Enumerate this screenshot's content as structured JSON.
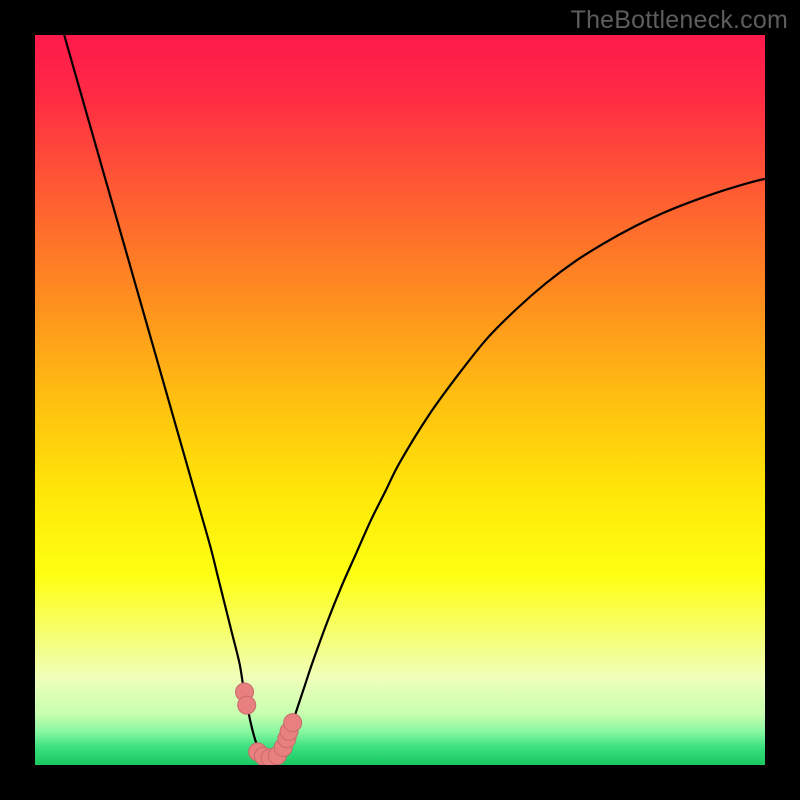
{
  "watermark": "TheBottleneck.com",
  "colors": {
    "frame": "#000000",
    "gradient_stops": [
      {
        "offset": 0.0,
        "color": "#ff1a4d"
      },
      {
        "offset": 0.08,
        "color": "#ff2a44"
      },
      {
        "offset": 0.2,
        "color": "#ff5635"
      },
      {
        "offset": 0.35,
        "color": "#ff8a20"
      },
      {
        "offset": 0.5,
        "color": "#ffbf10"
      },
      {
        "offset": 0.63,
        "color": "#ffe808"
      },
      {
        "offset": 0.74,
        "color": "#feff12"
      },
      {
        "offset": 0.82,
        "color": "#f6ff70"
      },
      {
        "offset": 0.88,
        "color": "#f0ffba"
      },
      {
        "offset": 0.93,
        "color": "#c8ffb0"
      },
      {
        "offset": 0.955,
        "color": "#86f7a0"
      },
      {
        "offset": 0.975,
        "color": "#3de180"
      },
      {
        "offset": 1.0,
        "color": "#18c85f"
      }
    ],
    "curve": "#000000",
    "markers_fill": "#e98080",
    "markers_stroke": "#c86a6a"
  },
  "chart_data": {
    "type": "line",
    "title": "",
    "xlabel": "",
    "ylabel": "",
    "xlim": [
      0,
      100
    ],
    "ylim": [
      0,
      100
    ],
    "series": [
      {
        "name": "bottleneck-curve",
        "x": [
          4,
          6,
          8,
          10,
          12,
          14,
          16,
          18,
          20,
          22,
          24,
          25,
          26,
          27,
          28,
          28.5,
          29,
          29.5,
          30,
          30.5,
          31,
          31.5,
          32,
          32.5,
          33,
          33.5,
          34,
          35,
          36,
          37,
          38,
          40,
          42,
          44,
          46,
          48,
          50,
          54,
          58,
          62,
          66,
          70,
          74,
          78,
          82,
          86,
          90,
          94,
          98,
          100
        ],
        "y": [
          100,
          93,
          86,
          79,
          72,
          65,
          58,
          51,
          44,
          37,
          30,
          26,
          22,
          18,
          14,
          11,
          8.5,
          6,
          4,
          2.5,
          1.6,
          1.1,
          0.9,
          0.9,
          1.1,
          1.6,
          2.5,
          5,
          8,
          11,
          14,
          19.5,
          24.5,
          29,
          33.5,
          37.5,
          41.5,
          48,
          53.5,
          58.5,
          62.5,
          66,
          69,
          71.5,
          73.7,
          75.6,
          77.2,
          78.6,
          79.8,
          80.3
        ]
      }
    ],
    "markers": {
      "name": "highlight-points",
      "x": [
        28.7,
        29.0,
        30.5,
        31.3,
        32.2,
        33.2,
        34.0,
        34.5,
        34.8,
        35.3
      ],
      "y": [
        10.0,
        8.2,
        1.8,
        1.2,
        1.0,
        1.3,
        2.4,
        3.6,
        4.6,
        5.8
      ]
    }
  }
}
